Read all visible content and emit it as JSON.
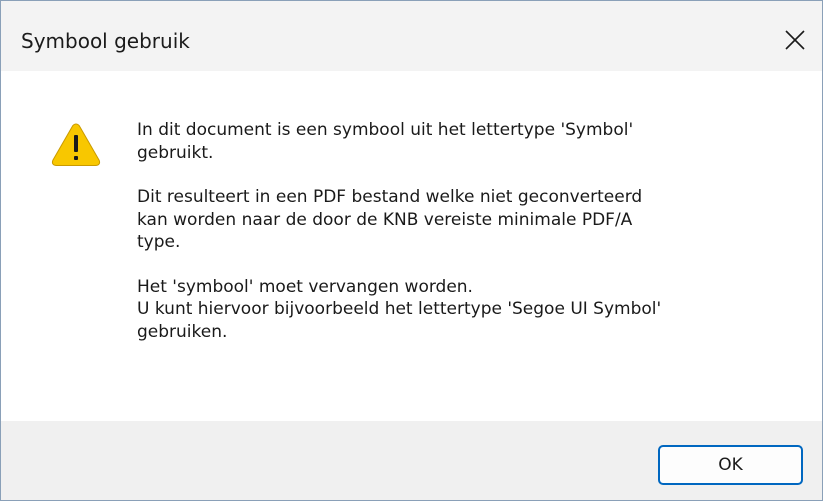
{
  "window": {
    "title": "Symbool gebruik",
    "close_icon": "close-icon"
  },
  "message": {
    "icon": "warning-icon",
    "paragraphs": [
      "In dit document is een symbool uit het lettertype 'Symbol'\ngebruikt.",
      "Dit resulteert in een PDF bestand welke niet geconverteerd\nkan worden naar de door de KNB vereiste minimale PDF/A\ntype.",
      "Het 'symbool' moet vervangen worden.\nU kunt hiervoor bijvoorbeeld het lettertype 'Segoe UI Symbol'\ngebruiken."
    ]
  },
  "buttons": {
    "ok_label": "OK"
  },
  "colors": {
    "accent": "#0067c0",
    "warning": "#f8c700",
    "titlebar": "#f3f3f3",
    "footer": "#f0f0f0"
  }
}
